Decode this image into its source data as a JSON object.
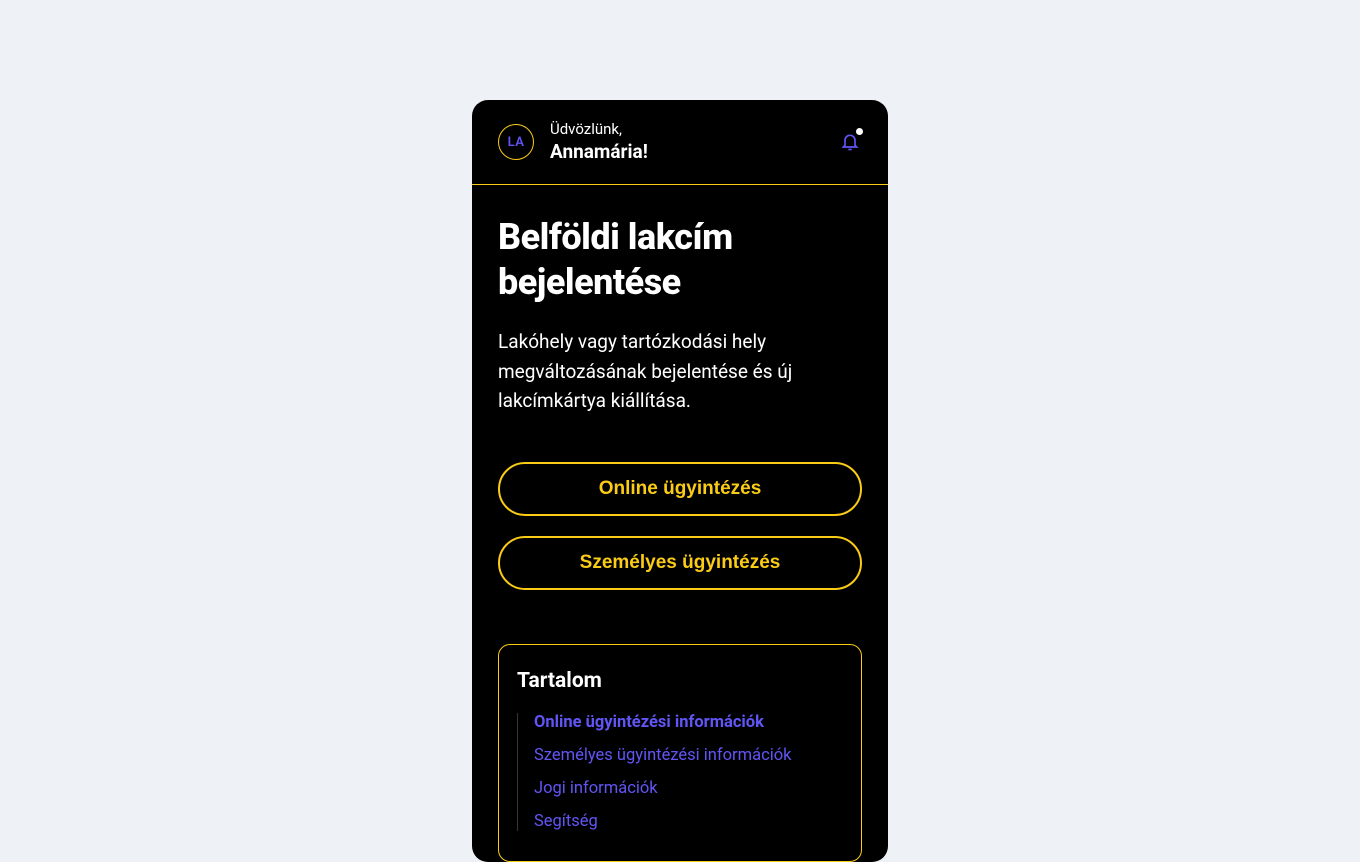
{
  "header": {
    "avatar_initials": "LA",
    "greeting_top": "Üdvözlünk,",
    "greeting_name": "Annamária!"
  },
  "page": {
    "title": "Belföldi lakcím bejelentése",
    "description": "Lakóhely vagy tartózkodási hely megváltozásának bejelentése és új lakcímkártya kiállítása."
  },
  "buttons": {
    "online_label": "Online ügyintézés",
    "inperson_label": "Személyes ügyintézés"
  },
  "toc": {
    "title": "Tartalom",
    "items": [
      "Online ügyintézési információk",
      "Személyes ügyintézési információk",
      "Jogi információk",
      "Segítség"
    ]
  }
}
